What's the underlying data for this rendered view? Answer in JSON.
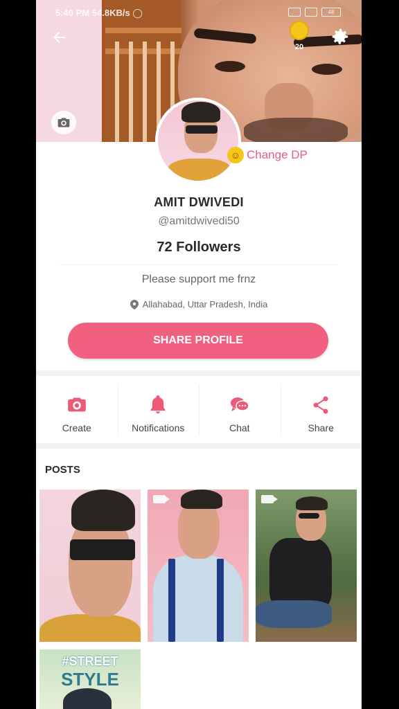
{
  "status_bar": {
    "time": "5:40 PM",
    "speed": "54.8KB/s",
    "battery": "48"
  },
  "header": {
    "coins_count": "20"
  },
  "profile": {
    "change_dp_label": "Change DP",
    "name": "AMIT DWIVEDI",
    "handle": "@amitdwivedi50",
    "followers": "72 Followers",
    "bio": "Please support me frnz",
    "location": "Allahabad, Uttar Pradesh, India",
    "share_button": "SHARE PROFILE"
  },
  "actions": [
    {
      "label": "Create",
      "icon": "camera-icon"
    },
    {
      "label": "Notifications",
      "icon": "bell-icon"
    },
    {
      "label": "Chat",
      "icon": "chat-icon"
    },
    {
      "label": "Share",
      "icon": "share-icon"
    }
  ],
  "posts": {
    "title": "POSTS",
    "items": [
      {
        "type": "image"
      },
      {
        "type": "video"
      },
      {
        "type": "video"
      },
      {
        "type": "image",
        "overlay_text": "#STREET",
        "overlay_text_2": "STYLE"
      }
    ]
  },
  "colors": {
    "accent": "#f1607f",
    "text_dark": "#2a2a2a",
    "text_muted": "#777777"
  }
}
